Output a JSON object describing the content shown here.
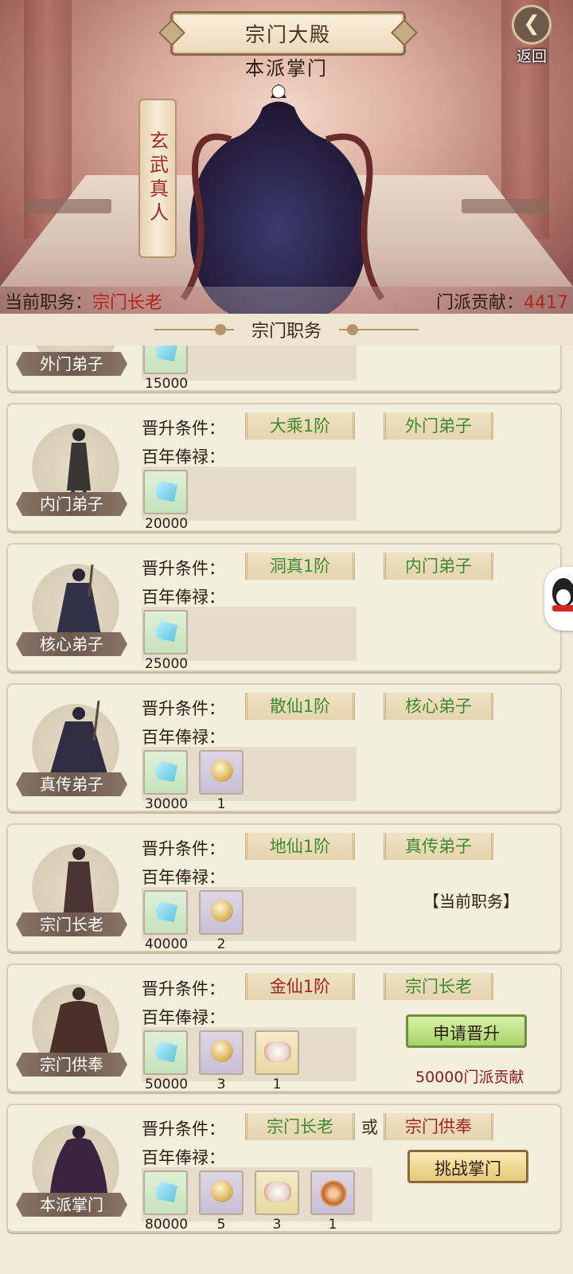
{
  "header": {
    "title": "宗门大殿",
    "back_label": "返回",
    "subtitle": "本派掌门",
    "master_name": "玄武真人",
    "current_post_label": "当前职务：",
    "current_post_value": "宗门长老",
    "contribution_label": "门派贡献：",
    "contribution_value": "4417"
  },
  "section": {
    "title": "宗门职务"
  },
  "labels": {
    "promote_condition": "晋升条件：",
    "salary": "百年俸禄：",
    "or": "或"
  },
  "ranks": [
    {
      "name": "外门弟子",
      "req1": "",
      "req2": "",
      "rewards": [
        "15000"
      ]
    },
    {
      "name": "内门弟子",
      "req1": "大乘1阶",
      "req2": "外门弟子",
      "rewards": [
        "20000"
      ]
    },
    {
      "name": "核心弟子",
      "req1": "洞真1阶",
      "req2": "内门弟子",
      "rewards": [
        "25000"
      ]
    },
    {
      "name": "真传弟子",
      "req1": "散仙1阶",
      "req2": "核心弟子",
      "rewards": [
        "30000",
        "1"
      ]
    },
    {
      "name": "宗门长老",
      "req1": "地仙1阶",
      "req2": "真传弟子",
      "rewards": [
        "40000",
        "2"
      ],
      "status": "【当前职务】"
    },
    {
      "name": "宗门供奉",
      "req1": "金仙1阶",
      "req2": "宗门长老",
      "rewards": [
        "50000",
        "3",
        "1"
      ],
      "button": "申请晋升",
      "cost": "50000门派贡献"
    },
    {
      "name": "本派掌门",
      "req1": "宗门长老",
      "req2": "宗门供奉",
      "rewards": [
        "80000",
        "5",
        "3",
        "1"
      ],
      "button": "挑战掌门"
    }
  ],
  "colors": {
    "accent_red": "#b1251f",
    "req_green": "#3f8a2e"
  }
}
